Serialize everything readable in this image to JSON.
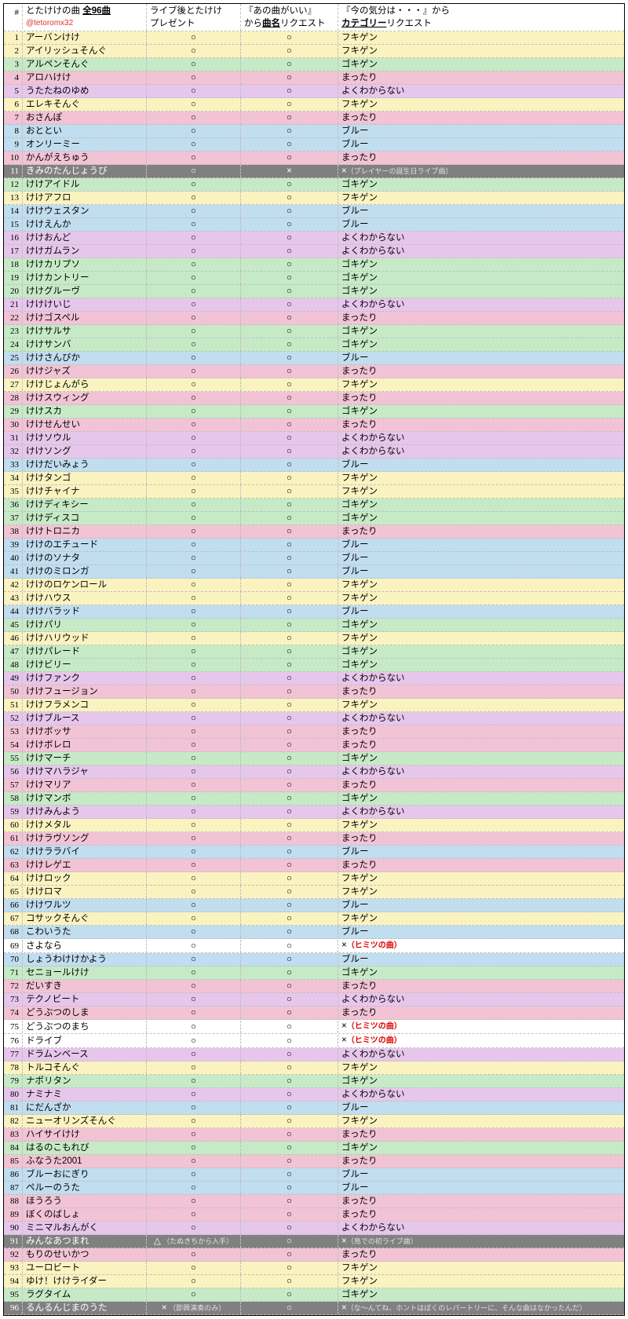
{
  "header": {
    "num": "#",
    "title_pre": "とたけけの曲 ",
    "title_bold": "全96曲",
    "handle": "@tetoromx32",
    "col2_l1": "ライブ後とたけけ",
    "col2_l2": "プレゼント",
    "col3_l1": "『あの曲がいい』",
    "col3_l2_pre": "から",
    "col3_l2_bold": "曲名",
    "col3_l2_post": "リクエスト",
    "col4_l1": "『今の気分は・・・』から",
    "col4_l2_bold": "カテゴリー",
    "col4_l2_post": "リクエスト"
  },
  "marks": {
    "o": "○",
    "x": "×",
    "tri": "△"
  },
  "rows": [
    {
      "n": 1,
      "name": "アーバンけけ",
      "c2": "○",
      "c3": "○",
      "c4": "フキゲン",
      "bg": "yellow"
    },
    {
      "n": 2,
      "name": "アイリッシュそんぐ",
      "c2": "○",
      "c3": "○",
      "c4": "フキゲン",
      "bg": "yellow"
    },
    {
      "n": 3,
      "name": "アルペンそんぐ",
      "c2": "○",
      "c3": "○",
      "c4": "ゴキゲン",
      "bg": "green"
    },
    {
      "n": 4,
      "name": "アロハけけ",
      "c2": "○",
      "c3": "○",
      "c4": "まったり",
      "bg": "pink"
    },
    {
      "n": 5,
      "name": "うたたねのゆめ",
      "c2": "○",
      "c3": "○",
      "c4": "よくわからない",
      "bg": "violet"
    },
    {
      "n": 6,
      "name": "エレキそんぐ",
      "c2": "○",
      "c3": "○",
      "c4": "フキゲン",
      "bg": "yellow"
    },
    {
      "n": 7,
      "name": "おさんぽ",
      "c2": "○",
      "c3": "○",
      "c4": "まったり",
      "bg": "pink"
    },
    {
      "n": 8,
      "name": "おととい",
      "c2": "○",
      "c3": "○",
      "c4": "ブルー",
      "bg": "blue"
    },
    {
      "n": 9,
      "name": "オンリーミー",
      "c2": "○",
      "c3": "○",
      "c4": "ブルー",
      "bg": "blue"
    },
    {
      "n": 10,
      "name": "かんがえちゅう",
      "c2": "○",
      "c3": "○",
      "c4": "まったり",
      "bg": "pink"
    },
    {
      "n": 11,
      "name": "きみのたんじょうび",
      "c2": "○",
      "c3": "×",
      "c4": "×",
      "note": "（プレイヤーの誕生日ライブ曲）",
      "bg": "gray"
    },
    {
      "n": 12,
      "name": "けけアイドル",
      "c2": "○",
      "c3": "○",
      "c4": "ゴキゲン",
      "bg": "green"
    },
    {
      "n": 13,
      "name": "けけアフロ",
      "c2": "○",
      "c3": "○",
      "c4": "フキゲン",
      "bg": "yellow"
    },
    {
      "n": 14,
      "name": "けけウェスタン",
      "c2": "○",
      "c3": "○",
      "c4": "ブルー",
      "bg": "blue"
    },
    {
      "n": 15,
      "name": "けけえんか",
      "c2": "○",
      "c3": "○",
      "c4": "ブルー",
      "bg": "blue"
    },
    {
      "n": 16,
      "name": "けけおんど",
      "c2": "○",
      "c3": "○",
      "c4": "よくわからない",
      "bg": "violet"
    },
    {
      "n": 17,
      "name": "けけガムラン",
      "c2": "○",
      "c3": "○",
      "c4": "よくわからない",
      "bg": "violet"
    },
    {
      "n": 18,
      "name": "けけカリプソ",
      "c2": "○",
      "c3": "○",
      "c4": "ゴキゲン",
      "bg": "green"
    },
    {
      "n": 19,
      "name": "けけカントリー",
      "c2": "○",
      "c3": "○",
      "c4": "ゴキゲン",
      "bg": "green"
    },
    {
      "n": 20,
      "name": "けけグルーヴ",
      "c2": "○",
      "c3": "○",
      "c4": "ゴキゲン",
      "bg": "green"
    },
    {
      "n": 21,
      "name": "けけけいじ",
      "c2": "○",
      "c3": "○",
      "c4": "よくわからない",
      "bg": "violet"
    },
    {
      "n": 22,
      "name": "けけゴスペル",
      "c2": "○",
      "c3": "○",
      "c4": "まったり",
      "bg": "pink"
    },
    {
      "n": 23,
      "name": "けけサルサ",
      "c2": "○",
      "c3": "○",
      "c4": "ゴキゲン",
      "bg": "green"
    },
    {
      "n": 24,
      "name": "けけサンバ",
      "c2": "○",
      "c3": "○",
      "c4": "ゴキゲン",
      "bg": "green"
    },
    {
      "n": 25,
      "name": "けけさんびか",
      "c2": "○",
      "c3": "○",
      "c4": "ブルー",
      "bg": "blue"
    },
    {
      "n": 26,
      "name": "けけジャズ",
      "c2": "○",
      "c3": "○",
      "c4": "まったり",
      "bg": "pink"
    },
    {
      "n": 27,
      "name": "けけじょんがら",
      "c2": "○",
      "c3": "○",
      "c4": "フキゲン",
      "bg": "yellow"
    },
    {
      "n": 28,
      "name": "けけスウィング",
      "c2": "○",
      "c3": "○",
      "c4": "まったり",
      "bg": "pink"
    },
    {
      "n": 29,
      "name": "けけスカ",
      "c2": "○",
      "c3": "○",
      "c4": "ゴキゲン",
      "bg": "green"
    },
    {
      "n": 30,
      "name": "けけせんせい",
      "c2": "○",
      "c3": "○",
      "c4": "まったり",
      "bg": "pink"
    },
    {
      "n": 31,
      "name": "けけソウル",
      "c2": "○",
      "c3": "○",
      "c4": "よくわからない",
      "bg": "violet"
    },
    {
      "n": 32,
      "name": "けけソング",
      "c2": "○",
      "c3": "○",
      "c4": "よくわからない",
      "bg": "violet"
    },
    {
      "n": 33,
      "name": "けけだいみょう",
      "c2": "○",
      "c3": "○",
      "c4": "ブルー",
      "bg": "blue"
    },
    {
      "n": 34,
      "name": "けけタンゴ",
      "c2": "○",
      "c3": "○",
      "c4": "フキゲン",
      "bg": "yellow"
    },
    {
      "n": 35,
      "name": "けけチャイナ",
      "c2": "○",
      "c3": "○",
      "c4": "フキゲン",
      "bg": "yellow"
    },
    {
      "n": 36,
      "name": "けけディキシー",
      "c2": "○",
      "c3": "○",
      "c4": "ゴキゲン",
      "bg": "green"
    },
    {
      "n": 37,
      "name": "けけディスコ",
      "c2": "○",
      "c3": "○",
      "c4": "ゴキゲン",
      "bg": "green"
    },
    {
      "n": 38,
      "name": "けけトロニカ",
      "c2": "○",
      "c3": "○",
      "c4": "まったり",
      "bg": "pink"
    },
    {
      "n": 39,
      "name": "けけのエチュード",
      "c2": "○",
      "c3": "○",
      "c4": "ブルー",
      "bg": "blue"
    },
    {
      "n": 40,
      "name": "けけのソナタ",
      "c2": "○",
      "c3": "○",
      "c4": "ブルー",
      "bg": "blue"
    },
    {
      "n": 41,
      "name": "けけのミロンガ",
      "c2": "○",
      "c3": "○",
      "c4": "ブルー",
      "bg": "blue"
    },
    {
      "n": 42,
      "name": "けけのロケンロール",
      "c2": "○",
      "c3": "○",
      "c4": "フキゲン",
      "bg": "yellow"
    },
    {
      "n": 43,
      "name": "けけハウス",
      "c2": "○",
      "c3": "○",
      "c4": "フキゲン",
      "bg": "yellow"
    },
    {
      "n": 44,
      "name": "けけバラッド",
      "c2": "○",
      "c3": "○",
      "c4": "ブルー",
      "bg": "blue"
    },
    {
      "n": 45,
      "name": "けけパリ",
      "c2": "○",
      "c3": "○",
      "c4": "ゴキゲン",
      "bg": "green"
    },
    {
      "n": 46,
      "name": "けけハリウッド",
      "c2": "○",
      "c3": "○",
      "c4": "フキゲン",
      "bg": "yellow"
    },
    {
      "n": 47,
      "name": "けけパレード",
      "c2": "○",
      "c3": "○",
      "c4": "ゴキゲン",
      "bg": "green"
    },
    {
      "n": 48,
      "name": "けけビリー",
      "c2": "○",
      "c3": "○",
      "c4": "ゴキゲン",
      "bg": "green"
    },
    {
      "n": 49,
      "name": "けけファンク",
      "c2": "○",
      "c3": "○",
      "c4": "よくわからない",
      "bg": "violet"
    },
    {
      "n": 50,
      "name": "けけフュージョン",
      "c2": "○",
      "c3": "○",
      "c4": "まったり",
      "bg": "pink"
    },
    {
      "n": 51,
      "name": "けけフラメンコ",
      "c2": "○",
      "c3": "○",
      "c4": "フキゲン",
      "bg": "yellow"
    },
    {
      "n": 52,
      "name": "けけブルース",
      "c2": "○",
      "c3": "○",
      "c4": "よくわからない",
      "bg": "violet"
    },
    {
      "n": 53,
      "name": "けけボッサ",
      "c2": "○",
      "c3": "○",
      "c4": "まったり",
      "bg": "pink"
    },
    {
      "n": 54,
      "name": "けけボレロ",
      "c2": "○",
      "c3": "○",
      "c4": "まったり",
      "bg": "pink"
    },
    {
      "n": 55,
      "name": "けけマーチ",
      "c2": "○",
      "c3": "○",
      "c4": "ゴキゲン",
      "bg": "green"
    },
    {
      "n": 56,
      "name": "けけマハラジャ",
      "c2": "○",
      "c3": "○",
      "c4": "よくわからない",
      "bg": "violet"
    },
    {
      "n": 57,
      "name": "けけマリア",
      "c2": "○",
      "c3": "○",
      "c4": "まったり",
      "bg": "pink"
    },
    {
      "n": 58,
      "name": "けけマンボ",
      "c2": "○",
      "c3": "○",
      "c4": "ゴキゲン",
      "bg": "green"
    },
    {
      "n": 59,
      "name": "けけみんよう",
      "c2": "○",
      "c3": "○",
      "c4": "よくわからない",
      "bg": "violet"
    },
    {
      "n": 60,
      "name": "けけメタル",
      "c2": "○",
      "c3": "○",
      "c4": "フキゲン",
      "bg": "yellow"
    },
    {
      "n": 61,
      "name": "けけラヴソング",
      "c2": "○",
      "c3": "○",
      "c4": "まったり",
      "bg": "pink"
    },
    {
      "n": 62,
      "name": "けけララバイ",
      "c2": "○",
      "c3": "○",
      "c4": "ブルー",
      "bg": "blue"
    },
    {
      "n": 63,
      "name": "けけレゲエ",
      "c2": "○",
      "c3": "○",
      "c4": "まったり",
      "bg": "pink"
    },
    {
      "n": 64,
      "name": "けけロック",
      "c2": "○",
      "c3": "○",
      "c4": "フキゲン",
      "bg": "yellow"
    },
    {
      "n": 65,
      "name": "けけロマ",
      "c2": "○",
      "c3": "○",
      "c4": "フキゲン",
      "bg": "yellow"
    },
    {
      "n": 66,
      "name": "けけワルツ",
      "c2": "○",
      "c3": "○",
      "c4": "ブルー",
      "bg": "blue"
    },
    {
      "n": 67,
      "name": "コサックそんぐ",
      "c2": "○",
      "c3": "○",
      "c4": "フキゲン",
      "bg": "yellow"
    },
    {
      "n": 68,
      "name": "こわいうた",
      "c2": "○",
      "c3": "○",
      "c4": "ブルー",
      "bg": "blue"
    },
    {
      "n": 69,
      "name": "さよなら",
      "c2": "○",
      "c3": "○",
      "c4": "×",
      "red": "（ヒミツの曲）",
      "bg": "white"
    },
    {
      "n": 70,
      "name": "しょうわけけかよう",
      "c2": "○",
      "c3": "○",
      "c4": "ブルー",
      "bg": "blue"
    },
    {
      "n": 71,
      "name": "セニョールけけ",
      "c2": "○",
      "c3": "○",
      "c4": "ゴキゲン",
      "bg": "green"
    },
    {
      "n": 72,
      "name": "だいすき",
      "c2": "○",
      "c3": "○",
      "c4": "まったり",
      "bg": "pink"
    },
    {
      "n": 73,
      "name": "テクノビート",
      "c2": "○",
      "c3": "○",
      "c4": "よくわからない",
      "bg": "violet"
    },
    {
      "n": 74,
      "name": "どうぶつのしま",
      "c2": "○",
      "c3": "○",
      "c4": "まったり",
      "bg": "pink"
    },
    {
      "n": 75,
      "name": "どうぶつのまち",
      "c2": "○",
      "c3": "○",
      "c4": "×",
      "red": "（ヒミツの曲）",
      "bg": "white"
    },
    {
      "n": 76,
      "name": "ドライブ",
      "c2": "○",
      "c3": "○",
      "c4": "×",
      "red": "（ヒミツの曲）",
      "bg": "white"
    },
    {
      "n": 77,
      "name": "ドラムンベース",
      "c2": "○",
      "c3": "○",
      "c4": "よくわからない",
      "bg": "violet"
    },
    {
      "n": 78,
      "name": "トルコそんぐ",
      "c2": "○",
      "c3": "○",
      "c4": "フキゲン",
      "bg": "yellow"
    },
    {
      "n": 79,
      "name": "ナポリタン",
      "c2": "○",
      "c3": "○",
      "c4": "ゴキゲン",
      "bg": "green"
    },
    {
      "n": 80,
      "name": "ナミナミ",
      "c2": "○",
      "c3": "○",
      "c4": "よくわからない",
      "bg": "violet"
    },
    {
      "n": 81,
      "name": "にだんざか",
      "c2": "○",
      "c3": "○",
      "c4": "ブルー",
      "bg": "blue"
    },
    {
      "n": 82,
      "name": "ニューオリンズそんぐ",
      "c2": "○",
      "c3": "○",
      "c4": "フキゲン",
      "bg": "yellow"
    },
    {
      "n": 83,
      "name": "ハイサイけけ",
      "c2": "○",
      "c3": "○",
      "c4": "まったり",
      "bg": "pink"
    },
    {
      "n": 84,
      "name": "はるのこもれび",
      "c2": "○",
      "c3": "○",
      "c4": "ゴキゲン",
      "bg": "green"
    },
    {
      "n": 85,
      "name": "ふなうた2001",
      "c2": "○",
      "c3": "○",
      "c4": "まったり",
      "bg": "pink"
    },
    {
      "n": 86,
      "name": "ブルーおにぎり",
      "c2": "○",
      "c3": "○",
      "c4": "ブルー",
      "bg": "blue"
    },
    {
      "n": 87,
      "name": "ペルーのうた",
      "c2": "○",
      "c3": "○",
      "c4": "ブルー",
      "bg": "blue"
    },
    {
      "n": 88,
      "name": "ほうろう",
      "c2": "○",
      "c3": "○",
      "c4": "まったり",
      "bg": "pink"
    },
    {
      "n": 89,
      "name": "ぼくのばしょ",
      "c2": "○",
      "c3": "○",
      "c4": "まったり",
      "bg": "pink"
    },
    {
      "n": 90,
      "name": "ミニマルおんがく",
      "c2": "○",
      "c3": "○",
      "c4": "よくわからない",
      "bg": "violet"
    },
    {
      "n": 91,
      "name": "みんなあつまれ",
      "c2": "△",
      "c2note": "（たぬきちから入手）",
      "c3": "○",
      "c4": "×",
      "note": "（島での初ライブ曲）",
      "bg": "gray"
    },
    {
      "n": 92,
      "name": "もりのせいかつ",
      "c2": "○",
      "c3": "○",
      "c4": "まったり",
      "bg": "pink"
    },
    {
      "n": 93,
      "name": "ユーロビート",
      "c2": "○",
      "c3": "○",
      "c4": "フキゲン",
      "bg": "yellow"
    },
    {
      "n": 94,
      "name": "ゆけ！けけライダー",
      "c2": "○",
      "c3": "○",
      "c4": "フキゲン",
      "bg": "yellow"
    },
    {
      "n": 95,
      "name": "ラグタイム",
      "c2": "○",
      "c3": "○",
      "c4": "ゴキゲン",
      "bg": "green"
    },
    {
      "n": 96,
      "name": "るんるんじまのうた",
      "c2": "×",
      "c2note": "（即興演奏のみ）",
      "c3": "○",
      "c4": "×",
      "note": "（な～んてね、ホントはぼくのレパートリーに、そんな曲はなかったんだ）",
      "bg": "gray"
    }
  ]
}
